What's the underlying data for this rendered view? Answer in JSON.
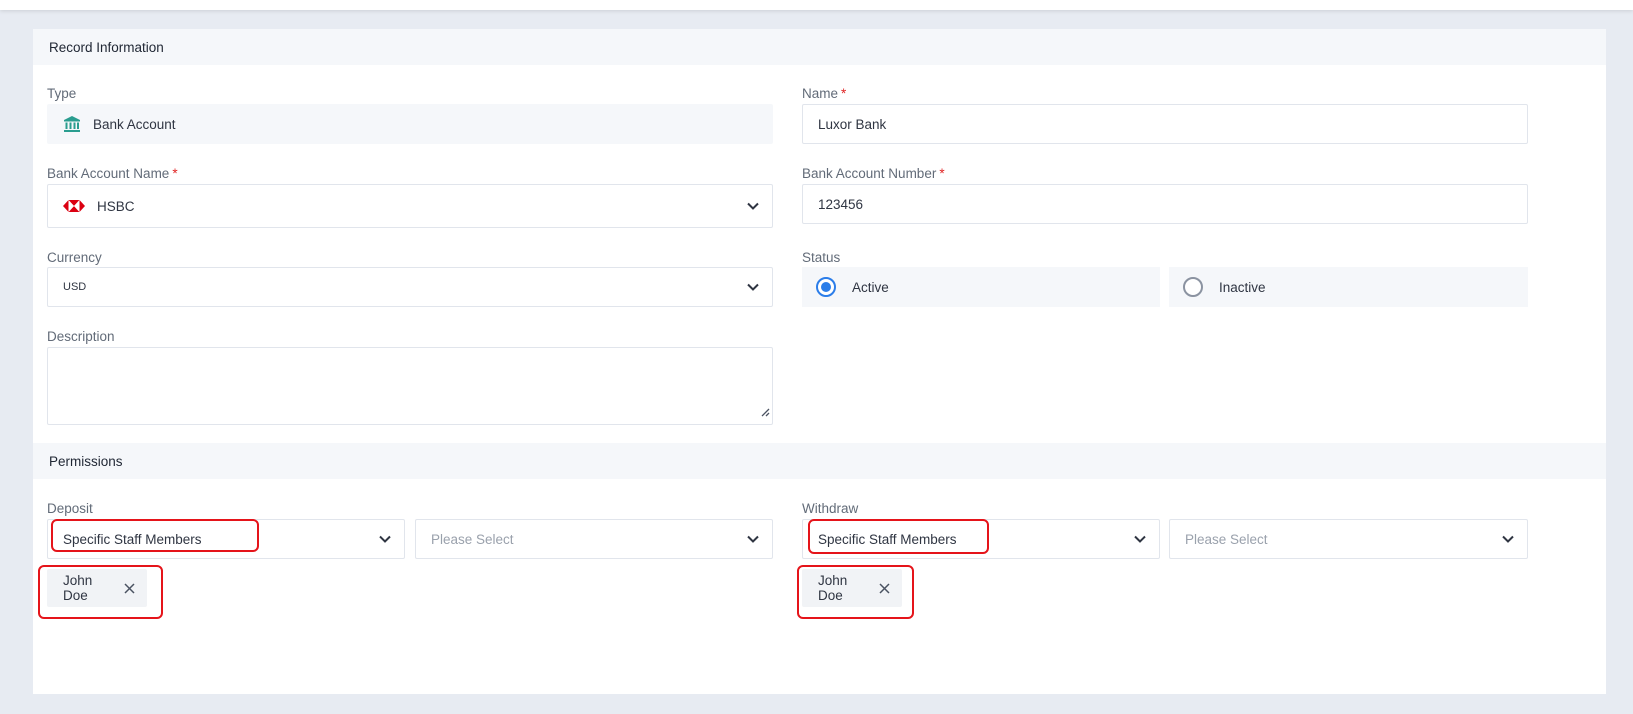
{
  "record_section": {
    "title": "Record Information"
  },
  "type": {
    "label": "Type",
    "value": "Bank Account",
    "icon": "bank-icon"
  },
  "name": {
    "label": "Name",
    "required": "*",
    "value": "Luxor Bank"
  },
  "bank_account_name": {
    "label": "Bank Account Name",
    "required": "*",
    "value": "HSBC",
    "icon": "hsbc-logo-icon"
  },
  "bank_account_number": {
    "label": "Bank Account Number",
    "required": "*",
    "value": "123456"
  },
  "currency": {
    "label": "Currency",
    "value": "USD"
  },
  "status": {
    "label": "Status",
    "options": [
      {
        "label": "Active",
        "selected": true
      },
      {
        "label": "Inactive",
        "selected": false
      }
    ]
  },
  "description": {
    "label": "Description",
    "value": ""
  },
  "permissions_section": {
    "title": "Permissions"
  },
  "deposit": {
    "label": "Deposit",
    "mode": "Specific Staff Members",
    "staff_placeholder": "Please Select",
    "chips": [
      "John Doe"
    ]
  },
  "withdraw": {
    "label": "Withdraw",
    "mode": "Specific Staff Members",
    "staff_placeholder": "Please Select",
    "chips": [
      "John Doe"
    ]
  },
  "colors": {
    "accent": "#2b7de9",
    "required": "#e02424",
    "highlight": "#e5141a",
    "bank_icon": "#2a9d8f",
    "hsbc": "#db0011"
  }
}
